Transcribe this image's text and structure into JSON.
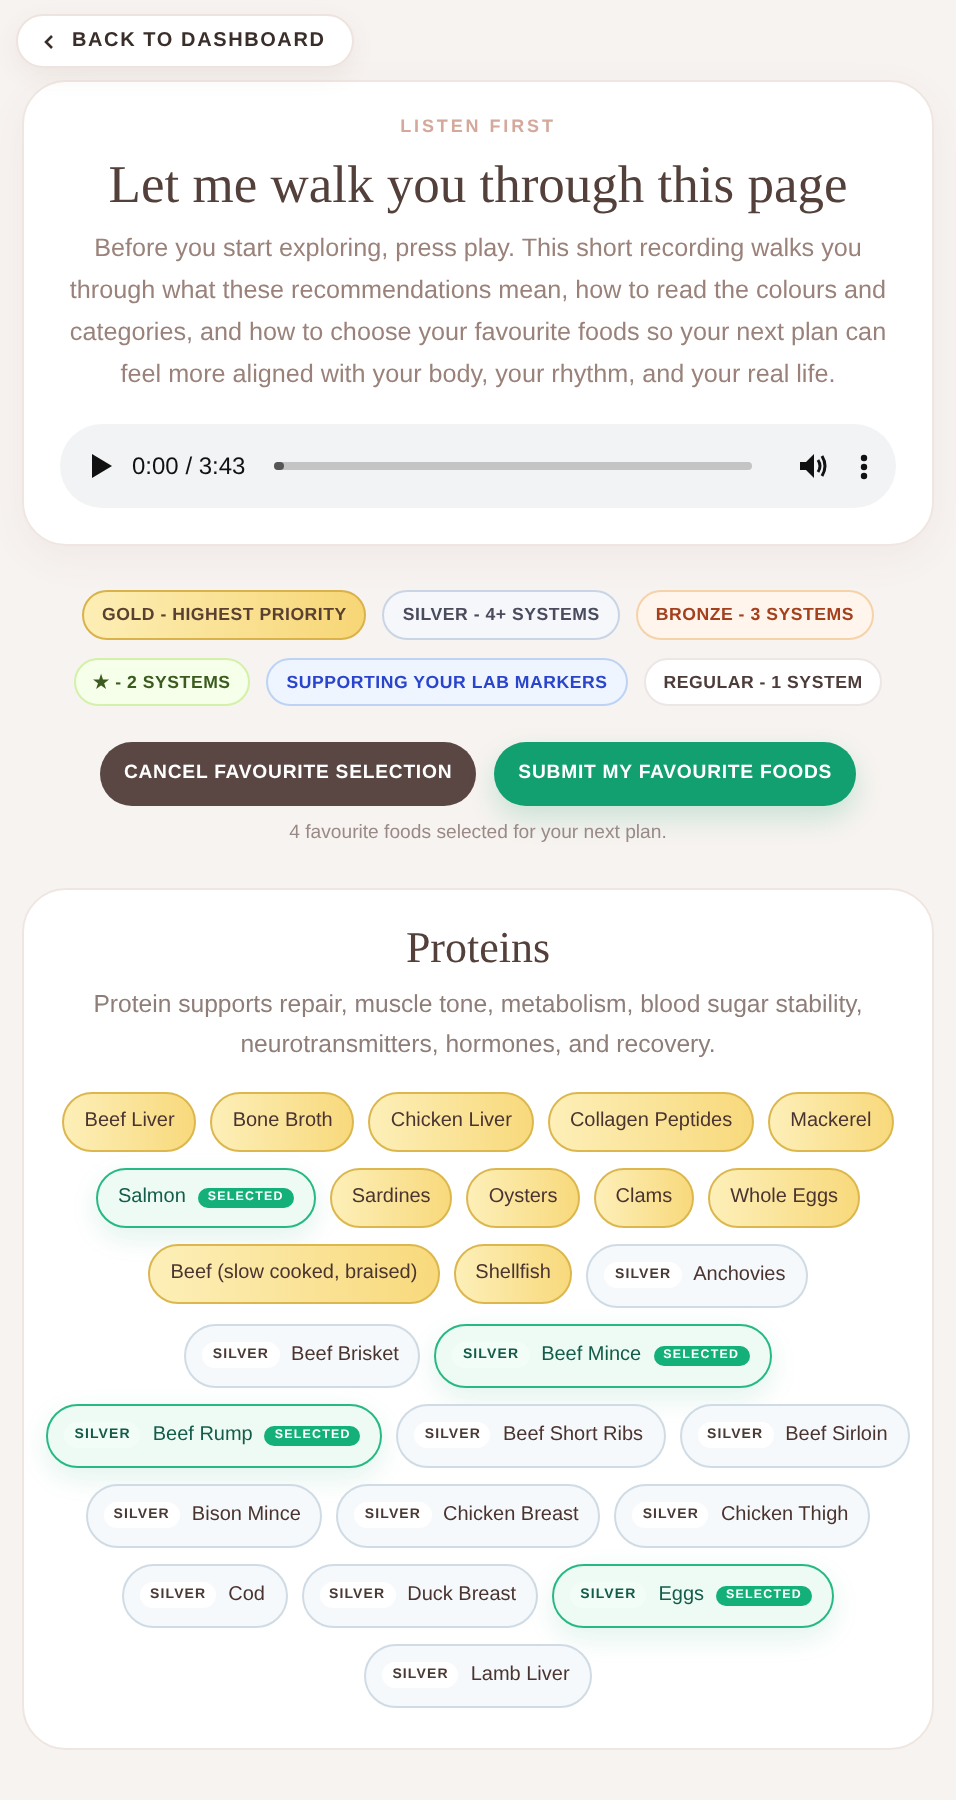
{
  "back_link": {
    "label": "BACK TO DASHBOARD"
  },
  "intro": {
    "eyebrow": "LISTEN FIRST",
    "title": "Let me walk you through this page",
    "text": "Before you start exploring, press play. This short recording walks you through what these recommendations mean, how to read the colours and categories, and how to choose your favourite foods so your next plan can feel more aligned with your body, your rhythm, and your real life.",
    "audio": {
      "time": "0:00 / 3:43",
      "level": 0.02
    }
  },
  "legend": [
    {
      "label": "GOLD - HIGHEST PRIORITY",
      "kind": "gold"
    },
    {
      "label": "SILVER - 4+ SYSTEMS",
      "kind": "silver"
    },
    {
      "label": "BRONZE - 3 SYSTEMS",
      "kind": "bronze"
    },
    {
      "label": "★ - 2 SYSTEMS",
      "kind": "star"
    },
    {
      "label": "SUPPORTING YOUR LAB MARKERS",
      "kind": "lab"
    },
    {
      "label": "REGULAR - 1 SYSTEM",
      "kind": "regular"
    }
  ],
  "actions": [
    {
      "label": "CANCEL FAVOURITE SELECTION",
      "kind": "secondary"
    },
    {
      "label": "SUBMIT MY FAVOURITE FOODS",
      "kind": "primary"
    }
  ],
  "selection_note": "4 favourite foods selected for your next plan.",
  "section": {
    "title": "Proteins",
    "description": "Protein supports repair, muscle tone, metabolism, blood sugar stability, neurotransmitters, hormones, and recovery.",
    "foods": [
      {
        "name": "Beef Liver",
        "kind": "gold",
        "selected": false
      },
      {
        "name": "Bone Broth",
        "kind": "gold",
        "selected": false
      },
      {
        "name": "Chicken Liver",
        "kind": "gold",
        "selected": false
      },
      {
        "name": "Collagen Peptides",
        "kind": "gold",
        "selected": false
      },
      {
        "name": "Mackerel",
        "kind": "gold",
        "selected": false
      },
      {
        "name": "Salmon",
        "kind": "gold",
        "selected": true,
        "badge": "SELECTED"
      },
      {
        "name": "Sardines",
        "kind": "gold",
        "selected": false
      },
      {
        "name": "Oysters",
        "kind": "gold",
        "selected": false
      },
      {
        "name": "Clams",
        "kind": "gold",
        "selected": false
      },
      {
        "name": "Whole Eggs",
        "kind": "gold",
        "selected": false
      },
      {
        "name": "Beef (slow cooked, braised)",
        "kind": "gold",
        "selected": false
      },
      {
        "name": "Shellfish",
        "kind": "gold",
        "selected": false
      },
      {
        "name": "Anchovies",
        "kind": "silver",
        "tag": "SILVER",
        "selected": false
      },
      {
        "name": "Beef Brisket",
        "kind": "silver",
        "tag": "SILVER",
        "selected": false
      },
      {
        "name": "Beef Mince",
        "kind": "silver",
        "tag": "SILVER",
        "selected": true,
        "badge": "SELECTED"
      },
      {
        "name": "Beef Rump",
        "kind": "silver",
        "tag": "SILVER",
        "selected": true,
        "badge": "SELECTED"
      },
      {
        "name": "Beef Short Ribs",
        "kind": "silver",
        "tag": "SILVER",
        "selected": false
      },
      {
        "name": "Beef Sirloin",
        "kind": "silver",
        "tag": "SILVER",
        "selected": false
      },
      {
        "name": "Bison Mince",
        "kind": "silver",
        "tag": "SILVER",
        "selected": false
      },
      {
        "name": "Chicken Breast",
        "kind": "silver",
        "tag": "SILVER",
        "selected": false
      },
      {
        "name": "Chicken Thigh",
        "kind": "silver",
        "tag": "SILVER",
        "selected": false
      },
      {
        "name": "Cod",
        "kind": "silver",
        "tag": "SILVER",
        "selected": false
      },
      {
        "name": "Duck Breast",
        "kind": "silver",
        "tag": "SILVER",
        "selected": false
      },
      {
        "name": "Eggs",
        "kind": "silver",
        "tag": "SILVER",
        "selected": true,
        "badge": "SELECTED"
      },
      {
        "name": "Lamb Liver",
        "kind": "silver",
        "tag": "SILVER",
        "selected": false
      }
    ]
  }
}
